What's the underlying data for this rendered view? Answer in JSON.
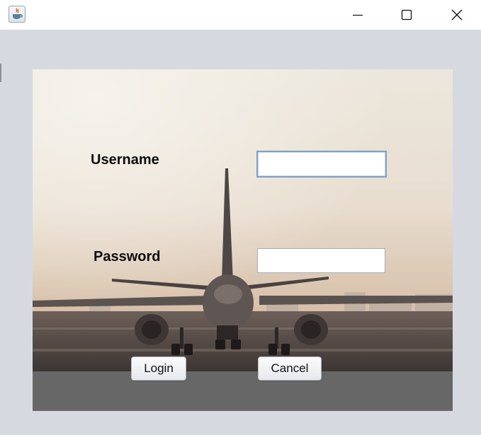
{
  "window": {
    "title": "",
    "controls": [
      "minimize",
      "maximize",
      "close"
    ]
  },
  "login_form": {
    "username_label": "Username",
    "password_label": "Password",
    "username_value": "",
    "password_value": "",
    "login_button": "Login",
    "cancel_button": "Cancel"
  },
  "background_image": {
    "subject": "airplane rear view on runway at hazy sunrise"
  },
  "colors": {
    "window_background": "#d6d9e0",
    "titlebar": "#ffffff",
    "bottom_band": "#676767",
    "focused_border": "#7aa2c8"
  }
}
